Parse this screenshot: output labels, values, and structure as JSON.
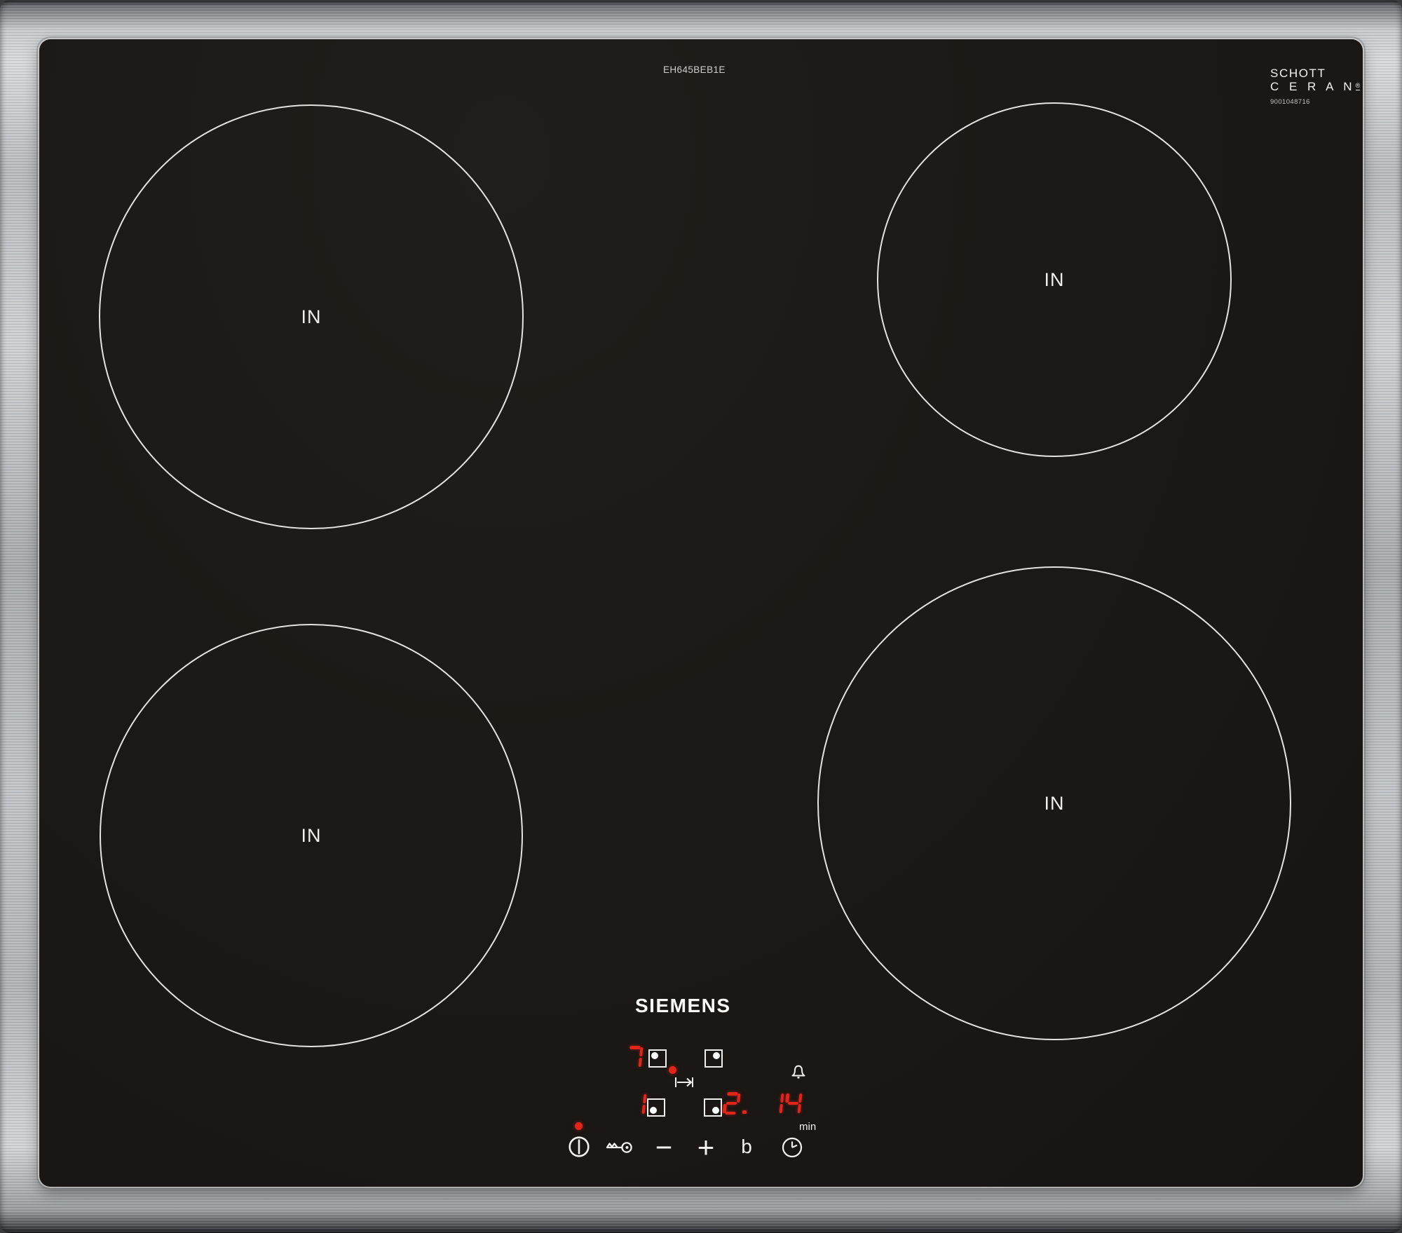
{
  "product": {
    "brand": "SIEMENS",
    "model_number": "EH645BEB1E",
    "glass_brand_line1": "SCHOTT",
    "glass_brand_line2": "C E R A N",
    "glass_brand_reg_mark": "®",
    "glass_code": "9001048716"
  },
  "zones": {
    "back_left_label": "IN",
    "back_right_label": "IN",
    "front_left_label": "IN",
    "front_right_label": "IN"
  },
  "display": {
    "back_left_level": "7",
    "front_left_level": "1",
    "front_right_level": "2.",
    "timer_minutes": "14",
    "timer_unit_label": "min"
  },
  "controls": {
    "minus_label": "−",
    "plus_label": "+",
    "booster_label": "b"
  },
  "colors": {
    "led_red": "#e3241b",
    "icon_white": "#f2f1ef",
    "glass_black": "#1b1815",
    "steel_gray": "#b7babd"
  }
}
